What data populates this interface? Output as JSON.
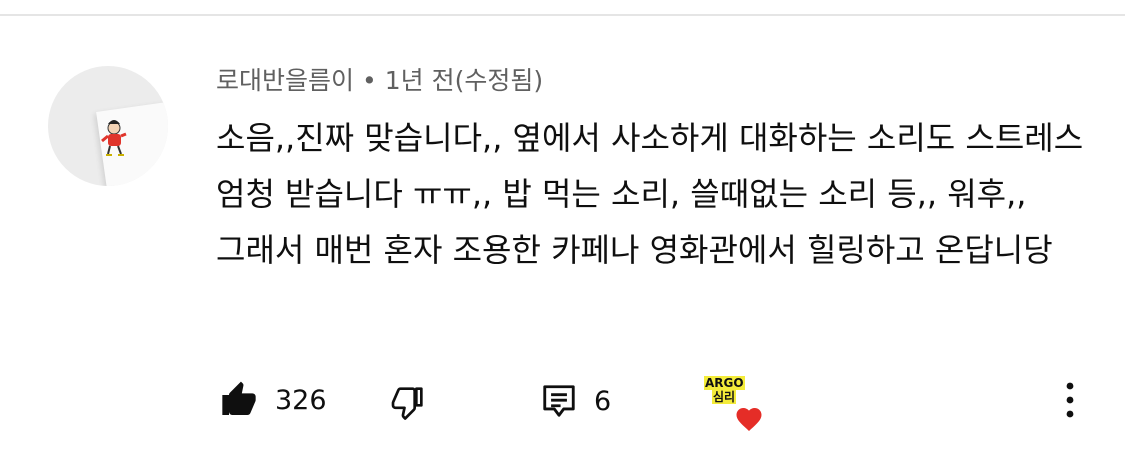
{
  "comment": {
    "author": "로대반을름이",
    "separator": "•",
    "time": "1년 전(수정됨)",
    "text": "소음,,진짜 맞습니다,, 옆에서 사소하게 대화하는 소리도 스트레스 엄청 받습니다 ㅠㅠ,, 밥 먹는 소리, 쓸때없는 소리 등,, 워후,, 그래서 매번 혼자 조용한 카페나 영화관에서 힐링하고 온답니당"
  },
  "actions": {
    "like_count": "326",
    "reply_count": "6",
    "like_icon": "thumbs-up-icon",
    "dislike_icon": "thumbs-down-icon",
    "reply_icon": "comment-icon",
    "more_icon": "more-vertical-icon"
  },
  "creator_badge": {
    "line1": "ARGO",
    "line2": "심리",
    "heart_color": "#e52d27",
    "badge_color": "#f4ec3a"
  }
}
